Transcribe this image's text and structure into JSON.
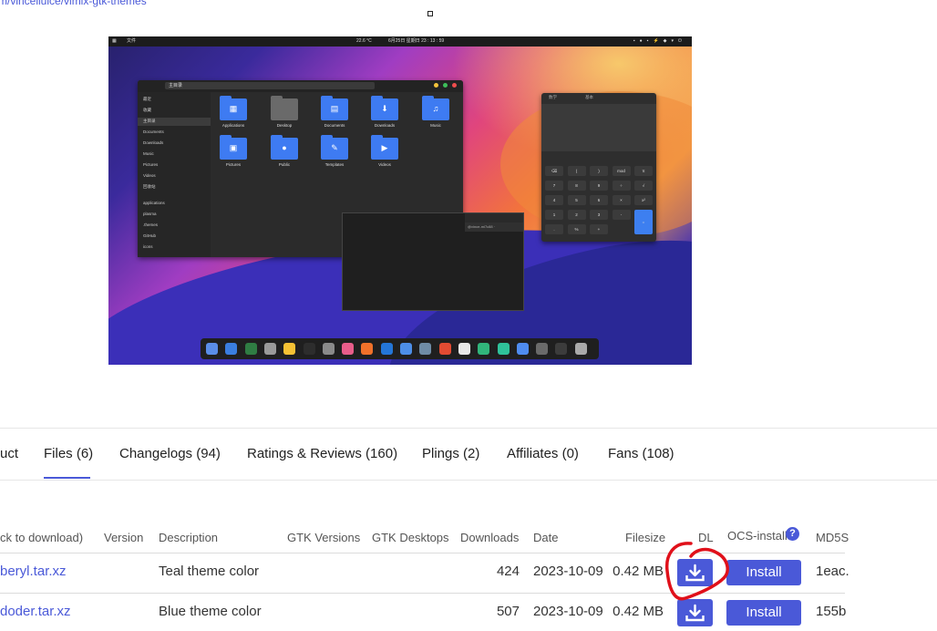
{
  "page": {
    "top_link": "m/vinceliuice/vimix-gtk-themes"
  },
  "preview": {
    "topbar": {
      "left": "文件",
      "weather": "22.6 °C",
      "datetime": "6月25日 星期日 23 : 13 : 59"
    },
    "file_manager": {
      "path": "主目录",
      "sidebar": [
        "最近",
        "收藏",
        "主目录",
        "Documents",
        "Downloads",
        "Music",
        "Pictures",
        "Videos",
        "回收站",
        "applications",
        "plasma",
        ".themes",
        "GitHub",
        "icons"
      ],
      "folders": [
        {
          "label": "Applications",
          "icon": "apps-icon"
        },
        {
          "label": "Desktop",
          "icon": "desktop-icon"
        },
        {
          "label": "Documents",
          "icon": "document-icon"
        },
        {
          "label": "Downloads",
          "icon": "download-icon"
        },
        {
          "label": "Music",
          "icon": "music-icon"
        },
        {
          "label": "Pictures",
          "icon": "picture-icon"
        },
        {
          "label": "Public",
          "icon": "person-icon"
        },
        {
          "label": "Templates",
          "icon": "template-icon"
        },
        {
          "label": "Videos",
          "icon": "video-icon"
        }
      ]
    },
    "calculator": {
      "mode": "基本",
      "title": "数学",
      "keys": [
        "⌫",
        "(",
        ")",
        "mod",
        "π",
        "7",
        "8",
        "9",
        "÷",
        "√",
        "4",
        "5",
        "6",
        "×",
        "x²",
        "1",
        "2",
        "3",
        "-",
        "0",
        ".",
        "%",
        "+",
        "="
      ]
    },
    "terminal": {
      "tab": "@vince-mi7c88 ·"
    }
  },
  "tabs": [
    {
      "label": "uct"
    },
    {
      "label": "Files (6)"
    },
    {
      "label": "Changelogs (94)"
    },
    {
      "label": "Ratings & Reviews (160)"
    },
    {
      "label": "Plings (2)"
    },
    {
      "label": "Affiliates (0)"
    },
    {
      "label": "Fans (108)"
    }
  ],
  "active_tab": "Files (6)",
  "table": {
    "headers": {
      "file": "ck to download)",
      "version": "Version",
      "description": "Description",
      "gtk_versions": "GTK Versions",
      "gtk_desktops": "GTK Desktops",
      "downloads": "Downloads",
      "date": "Date",
      "filesize": "Filesize",
      "dl": "DL",
      "ocs": "OCS-install",
      "md5": "MD5S"
    },
    "help_glyph": "?",
    "rows": [
      {
        "file": "beryl.tar.xz",
        "description": "Teal theme color",
        "downloads": "424",
        "date": "2023-10-09",
        "filesize": "0.42 MB",
        "install": "Install",
        "md5": "1eac."
      },
      {
        "file": "doder.tar.xz",
        "description": "Blue theme color",
        "downloads": "507",
        "date": "2023-10-09",
        "filesize": "0.42 MB",
        "install": "Install",
        "md5": "155b"
      }
    ]
  },
  "colors": {
    "accent": "#4a59d8",
    "annotation": "#e0101a"
  }
}
